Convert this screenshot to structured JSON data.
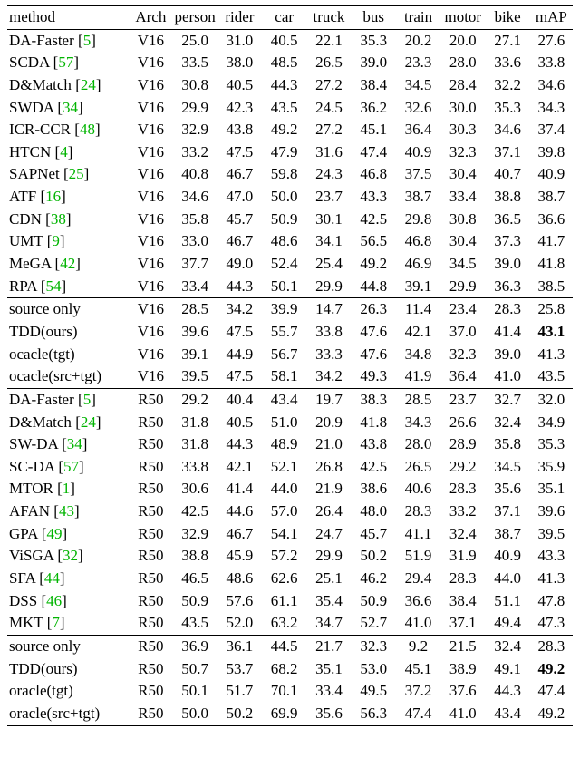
{
  "chart_data": {
    "type": "table",
    "title": "",
    "columns": [
      "method",
      "Arch",
      "person",
      "rider",
      "car",
      "truck",
      "bus",
      "train",
      "motor",
      "bike",
      "mAP"
    ],
    "groups": [
      {
        "rows": [
          {
            "method": "DA-Faster",
            "cite": "5",
            "arch": "V16",
            "vals": [
              "25.0",
              "31.0",
              "40.5",
              "22.1",
              "35.3",
              "20.2",
              "20.0",
              "27.1",
              "27.6"
            ]
          },
          {
            "method": "SCDA",
            "cite": "57",
            "arch": "V16",
            "vals": [
              "33.5",
              "38.0",
              "48.5",
              "26.5",
              "39.0",
              "23.3",
              "28.0",
              "33.6",
              "33.8"
            ]
          },
          {
            "method": "D&Match",
            "cite": "24",
            "arch": "V16",
            "vals": [
              "30.8",
              "40.5",
              "44.3",
              "27.2",
              "38.4",
              "34.5",
              "28.4",
              "32.2",
              "34.6"
            ]
          },
          {
            "method": "SWDA",
            "cite": "34",
            "arch": "V16",
            "vals": [
              "29.9",
              "42.3",
              "43.5",
              "24.5",
              "36.2",
              "32.6",
              "30.0",
              "35.3",
              "34.3"
            ]
          },
          {
            "method": "ICR-CCR",
            "cite": "48",
            "arch": "V16",
            "vals": [
              "32.9",
              "43.8",
              "49.2",
              "27.2",
              "45.1",
              "36.4",
              "30.3",
              "34.6",
              "37.4"
            ]
          },
          {
            "method": "HTCN",
            "cite": "4",
            "arch": "V16",
            "vals": [
              "33.2",
              "47.5",
              "47.9",
              "31.6",
              "47.4",
              "40.9",
              "32.3",
              "37.1",
              "39.8"
            ]
          },
          {
            "method": "SAPNet",
            "cite": "25",
            "arch": "V16",
            "vals": [
              "40.8",
              "46.7",
              "59.8",
              "24.3",
              "46.8",
              "37.5",
              "30.4",
              "40.7",
              "40.9"
            ]
          },
          {
            "method": "ATF",
            "cite": "16",
            "arch": "V16",
            "vals": [
              "34.6",
              "47.0",
              "50.0",
              "23.7",
              "43.3",
              "38.7",
              "33.4",
              "38.8",
              "38.7"
            ]
          },
          {
            "method": "CDN",
            "cite": "38",
            "arch": "V16",
            "vals": [
              "35.8",
              "45.7",
              "50.9",
              "30.1",
              "42.5",
              "29.8",
              "30.8",
              "36.5",
              "36.6"
            ]
          },
          {
            "method": "UMT",
            "cite": "9",
            "arch": "V16",
            "vals": [
              "33.0",
              "46.7",
              "48.6",
              "34.1",
              "56.5",
              "46.8",
              "30.4",
              "37.3",
              "41.7"
            ]
          },
          {
            "method": "MeGA",
            "cite": "42",
            "arch": "V16",
            "vals": [
              "37.7",
              "49.0",
              "52.4",
              "25.4",
              "49.2",
              "46.9",
              "34.5",
              "39.0",
              "41.8"
            ]
          },
          {
            "method": "RPA",
            "cite": "54",
            "arch": "V16",
            "vals": [
              "33.4",
              "44.3",
              "50.1",
              "29.9",
              "44.8",
              "39.1",
              "29.9",
              "36.3",
              "38.5"
            ]
          }
        ]
      },
      {
        "rows": [
          {
            "method": "source only",
            "cite": null,
            "arch": "V16",
            "vals": [
              "28.5",
              "34.2",
              "39.9",
              "14.7",
              "26.3",
              "11.4",
              "23.4",
              "28.3",
              "25.8"
            ]
          },
          {
            "method": "TDD(ours)",
            "cite": null,
            "arch": "V16",
            "vals": [
              "39.6",
              "47.5",
              "55.7",
              "33.8",
              "47.6",
              "42.1",
              "37.0",
              "41.4",
              "43.1"
            ],
            "bold_last": true
          },
          {
            "method": "ocacle(tgt)",
            "cite": null,
            "arch": "V16",
            "vals": [
              "39.1",
              "44.9",
              "56.7",
              "33.3",
              "47.6",
              "34.8",
              "32.3",
              "39.0",
              "41.3"
            ]
          },
          {
            "method": "ocacle(src+tgt)",
            "cite": null,
            "arch": "V16",
            "vals": [
              "39.5",
              "47.5",
              "58.1",
              "34.2",
              "49.3",
              "41.9",
              "36.4",
              "41.0",
              "43.5"
            ]
          }
        ]
      },
      {
        "rows": [
          {
            "method": "DA-Faster",
            "cite": "5",
            "arch": "R50",
            "vals": [
              "29.2",
              "40.4",
              "43.4",
              "19.7",
              "38.3",
              "28.5",
              "23.7",
              "32.7",
              "32.0"
            ]
          },
          {
            "method": "D&Match",
            "cite": "24",
            "arch": "R50",
            "vals": [
              "31.8",
              "40.5",
              "51.0",
              "20.9",
              "41.8",
              "34.3",
              "26.6",
              "32.4",
              "34.9"
            ]
          },
          {
            "method": "SW-DA",
            "cite": "34",
            "arch": "R50",
            "vals": [
              "31.8",
              "44.3",
              "48.9",
              "21.0",
              "43.8",
              "28.0",
              "28.9",
              "35.8",
              "35.3"
            ]
          },
          {
            "method": "SC-DA",
            "cite": "57",
            "arch": "R50",
            "vals": [
              "33.8",
              "42.1",
              "52.1",
              "26.8",
              "42.5",
              "26.5",
              "29.2",
              "34.5",
              "35.9"
            ]
          },
          {
            "method": "MTOR",
            "cite": "1",
            "arch": "R50",
            "vals": [
              "30.6",
              "41.4",
              "44.0",
              "21.9",
              "38.6",
              "40.6",
              "28.3",
              "35.6",
              "35.1"
            ]
          },
          {
            "method": "AFAN",
            "cite": "43",
            "arch": "R50",
            "vals": [
              "42.5",
              "44.6",
              "57.0",
              "26.4",
              "48.0",
              "28.3",
              "33.2",
              "37.1",
              "39.6"
            ]
          },
          {
            "method": "GPA",
            "cite": "49",
            "arch": "R50",
            "vals": [
              "32.9",
              "46.7",
              "54.1",
              "24.7",
              "45.7",
              "41.1",
              "32.4",
              "38.7",
              "39.5"
            ]
          },
          {
            "method": "ViSGA",
            "cite": "32",
            "arch": "R50",
            "vals": [
              "38.8",
              "45.9",
              "57.2",
              "29.9",
              "50.2",
              "51.9",
              "31.9",
              "40.9",
              "43.3"
            ]
          },
          {
            "method": "SFA",
            "cite": "44",
            "arch": "R50",
            "vals": [
              "46.5",
              "48.6",
              "62.6",
              "25.1",
              "46.2",
              "29.4",
              "28.3",
              "44.0",
              "41.3"
            ]
          },
          {
            "method": "DSS",
            "cite": "46",
            "arch": "R50",
            "vals": [
              "50.9",
              "57.6",
              "61.1",
              "35.4",
              "50.9",
              "36.6",
              "38.4",
              "51.1",
              "47.8"
            ]
          },
          {
            "method": "MKT",
            "cite": "7",
            "arch": "R50",
            "vals": [
              "43.5",
              "52.0",
              "63.2",
              "34.7",
              "52.7",
              "41.0",
              "37.1",
              "49.4",
              "47.3"
            ]
          }
        ]
      },
      {
        "rows": [
          {
            "method": "source only",
            "cite": null,
            "arch": "R50",
            "vals": [
              "36.9",
              "36.1",
              "44.5",
              "21.7",
              "32.3",
              "9.2",
              "21.5",
              "32.4",
              "28.3"
            ]
          },
          {
            "method": "TDD(ours)",
            "cite": null,
            "arch": "R50",
            "vals": [
              "50.7",
              "53.7",
              "68.2",
              "35.1",
              "53.0",
              "45.1",
              "38.9",
              "49.1",
              "49.2"
            ],
            "bold_last": true
          },
          {
            "method": "oracle(tgt)",
            "cite": null,
            "arch": "R50",
            "vals": [
              "50.1",
              "51.7",
              "70.1",
              "33.4",
              "49.5",
              "37.2",
              "37.6",
              "44.3",
              "47.4"
            ]
          },
          {
            "method": "oracle(src+tgt)",
            "cite": null,
            "arch": "R50",
            "vals": [
              "50.0",
              "50.2",
              "69.9",
              "35.6",
              "56.3",
              "47.4",
              "41.0",
              "43.4",
              "49.2"
            ]
          }
        ]
      }
    ]
  }
}
